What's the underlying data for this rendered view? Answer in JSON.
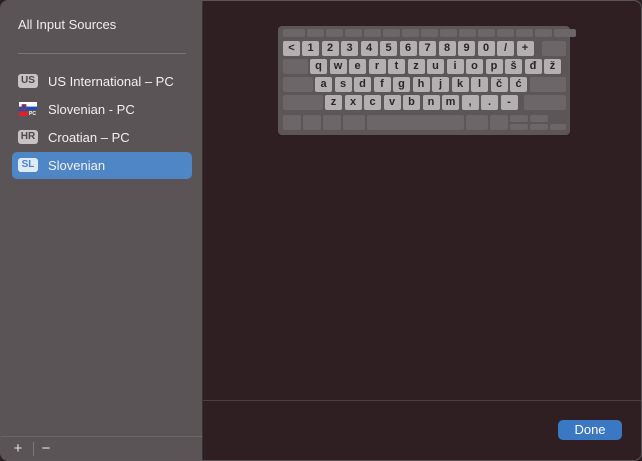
{
  "sidebar": {
    "title": "All Input Sources",
    "items": [
      {
        "badge": "US",
        "label": "US International – PC",
        "selected": false
      },
      {
        "badge": "",
        "icon": "slovenian-flag-icon",
        "label": "Slovenian - PC",
        "selected": false
      },
      {
        "badge": "HR",
        "label": "Croatian – PC",
        "selected": false
      },
      {
        "badge": "SL",
        "label": "Slovenian",
        "selected": true
      }
    ],
    "add_label": "+",
    "remove_label": "−"
  },
  "keyboard": {
    "row1": [
      "<",
      "1",
      "2",
      "3",
      "4",
      "5",
      "6",
      "7",
      "8",
      "9",
      "0",
      "/",
      "+"
    ],
    "row2": [
      "q",
      "w",
      "e",
      "r",
      "t",
      "z",
      "u",
      "i",
      "o",
      "p",
      "š",
      "đ",
      "ž"
    ],
    "row3": [
      "a",
      "s",
      "d",
      "f",
      "g",
      "h",
      "j",
      "k",
      "l",
      "č",
      "ć"
    ],
    "row4": [
      "z",
      "x",
      "c",
      "v",
      "b",
      "n",
      "m",
      ",",
      ".",
      "-"
    ]
  },
  "footer": {
    "done_label": "Done"
  },
  "colors": {
    "accent": "#4f86c6",
    "done": "#3a78c4",
    "sidebar": "#5a5456",
    "main_bg": "#2f1f22"
  }
}
